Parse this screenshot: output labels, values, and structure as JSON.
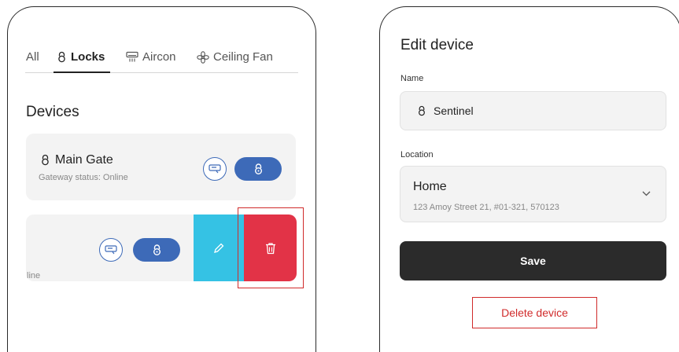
{
  "left_screen": {
    "tabs": [
      {
        "label": "All",
        "icon": null
      },
      {
        "label": "Locks",
        "icon": "lock-icon"
      },
      {
        "label": "Aircon",
        "icon": "aircon-icon"
      },
      {
        "label": "Ceiling Fan",
        "icon": "fan-icon"
      }
    ],
    "section_title": "Devices",
    "devices": [
      {
        "name": "Main Gate",
        "status": "Gateway status: Online"
      },
      {
        "status_partial": "line"
      }
    ]
  },
  "right_screen": {
    "title": "Edit device",
    "name_label": "Name",
    "name_value": "Sentinel",
    "location_label": "Location",
    "location_name": "Home",
    "location_address": "123 Amoy Street 21, #01-321, 570123",
    "save_label": "Save",
    "delete_label": "Delete device"
  },
  "colors": {
    "accent_blue": "#3d6ab8",
    "edit_cyan": "#35c2e4",
    "delete_red": "#e23347",
    "highlight_red": "#d02b2b",
    "save_dark": "#2b2b2b"
  }
}
